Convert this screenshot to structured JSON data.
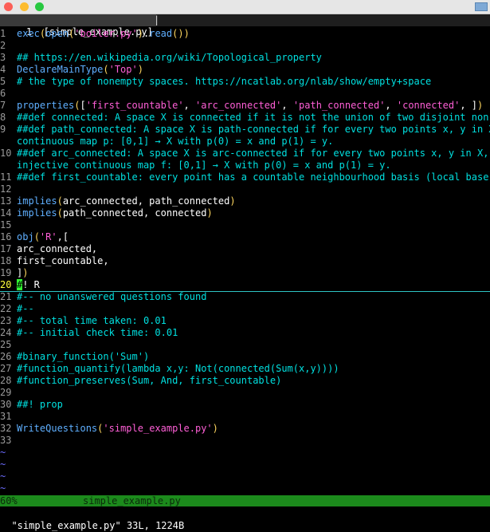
{
  "window": {
    "tab_number": "1",
    "tab_title": "[simple_example.py]",
    "tab_separator": "|"
  },
  "colors": {
    "function": "#5fafff",
    "string": "#ff5fd7",
    "paren": "#ffd75f",
    "comment": "#00e0e0",
    "normal": "#ffffff",
    "cursor": "#33ff33",
    "statusline_bg": "#1c8a1c"
  },
  "buffer": {
    "lines": [
      {
        "n": "1",
        "segs": [
          [
            "func",
            "exec"
          ],
          [
            "paren",
            "("
          ],
          [
            "func",
            "open"
          ],
          [
            "paren",
            "("
          ],
          [
            "str",
            "'boiler.py'"
          ],
          [
            "paren",
            ")"
          ],
          [
            "normal",
            "."
          ],
          [
            "func",
            "read"
          ],
          [
            "paren",
            "()"
          ],
          [
            "paren",
            ")"
          ]
        ]
      },
      {
        "n": "2",
        "segs": []
      },
      {
        "n": "3",
        "segs": [
          [
            "comment",
            "## https://en.wikipedia.org/wiki/Topological_property"
          ]
        ]
      },
      {
        "n": "4",
        "segs": [
          [
            "func",
            "DeclareMainType"
          ],
          [
            "paren",
            "("
          ],
          [
            "str",
            "'Top'"
          ],
          [
            "paren",
            ")"
          ]
        ]
      },
      {
        "n": "5",
        "segs": [
          [
            "comment",
            "# the type of nonempty spaces. https://ncatlab.org/nlab/show/empty+space"
          ]
        ]
      },
      {
        "n": "6",
        "segs": []
      },
      {
        "n": "7",
        "segs": [
          [
            "func",
            "properties"
          ],
          [
            "paren",
            "("
          ],
          [
            "normal",
            "["
          ],
          [
            "str",
            "'first_countable'"
          ],
          [
            "normal",
            ", "
          ],
          [
            "str",
            "'arc_connected'"
          ],
          [
            "normal",
            ", "
          ],
          [
            "str",
            "'path_connected'"
          ],
          [
            "normal",
            ", "
          ],
          [
            "str",
            "'connected'"
          ],
          [
            "normal",
            ", ]"
          ],
          [
            "paren",
            ")"
          ]
        ]
      },
      {
        "n": "8",
        "segs": [
          [
            "comment",
            "##def connected: A space X is connected if it is not the union of two disjoint non-em"
          ]
        ]
      },
      {
        "n": "9",
        "segs": [
          [
            "comment",
            "##def path_connected: A space X is path-connected if for every two points x, y in X,"
          ]
        ]
      },
      {
        "n": "",
        "segs": [
          [
            "comment",
            "continuous map p: [0,1] → X with p(0) = x and p(1) = y."
          ]
        ]
      },
      {
        "n": "10",
        "segs": [
          [
            "comment",
            "##def arc_connected: A space X is arc-connected if for every two points x, y in X, th"
          ]
        ]
      },
      {
        "n": "",
        "segs": [
          [
            "comment",
            "injective continuous map f: [0,1] → X with p(0) = x and p(1) = y."
          ]
        ]
      },
      {
        "n": "11",
        "segs": [
          [
            "comment",
            "##def first_countable: every point has a countable neighbourhood basis (local base)"
          ]
        ]
      },
      {
        "n": "12",
        "segs": []
      },
      {
        "n": "13",
        "segs": [
          [
            "func",
            "implies"
          ],
          [
            "paren",
            "("
          ],
          [
            "normal",
            "arc_connected, path_connected"
          ],
          [
            "paren",
            ")"
          ]
        ]
      },
      {
        "n": "14",
        "segs": [
          [
            "func",
            "implies"
          ],
          [
            "paren",
            "("
          ],
          [
            "normal",
            "path_connected, connected"
          ],
          [
            "paren",
            ")"
          ]
        ]
      },
      {
        "n": "15",
        "segs": []
      },
      {
        "n": "16",
        "segs": [
          [
            "func",
            "obj"
          ],
          [
            "paren",
            "("
          ],
          [
            "str",
            "'R'"
          ],
          [
            "normal",
            ",["
          ]
        ]
      },
      {
        "n": "17",
        "segs": [
          [
            "normal",
            "arc_connected,"
          ]
        ]
      },
      {
        "n": "18",
        "segs": [
          [
            "normal",
            "first_countable,"
          ]
        ]
      },
      {
        "n": "19",
        "segs": [
          [
            "normal",
            "]"
          ],
          [
            "paren",
            ")"
          ]
        ]
      },
      {
        "n": "20",
        "cur": true,
        "segs": [
          [
            "cursor",
            "#"
          ],
          [
            "normal",
            "! R"
          ]
        ]
      },
      {
        "n": "21",
        "segs": [
          [
            "comment",
            "#-- no unanswered questions found"
          ]
        ]
      },
      {
        "n": "22",
        "segs": [
          [
            "comment",
            "#--"
          ]
        ]
      },
      {
        "n": "23",
        "segs": [
          [
            "comment",
            "#-- total time taken: 0.01"
          ]
        ]
      },
      {
        "n": "24",
        "segs": [
          [
            "comment",
            "#-- initial check time: 0.01"
          ]
        ]
      },
      {
        "n": "25",
        "segs": []
      },
      {
        "n": "26",
        "segs": [
          [
            "comment",
            "#binary_function('Sum')"
          ]
        ]
      },
      {
        "n": "27",
        "segs": [
          [
            "comment",
            "#function_quantify(lambda x,y: Not(connected(Sum(x,y))))"
          ]
        ]
      },
      {
        "n": "28",
        "segs": [
          [
            "comment",
            "#function_preserves(Sum, And, first_countable)"
          ]
        ]
      },
      {
        "n": "29",
        "segs": []
      },
      {
        "n": "30",
        "segs": [
          [
            "comment",
            "##! prop"
          ]
        ]
      },
      {
        "n": "31",
        "segs": []
      },
      {
        "n": "32",
        "segs": [
          [
            "func",
            "WriteQuestions"
          ],
          [
            "paren",
            "("
          ],
          [
            "str",
            "'simple_example.py'"
          ],
          [
            "paren",
            ")"
          ]
        ]
      },
      {
        "n": "33",
        "segs": []
      },
      {
        "n": "~",
        "tilde": true,
        "segs": []
      },
      {
        "n": "~",
        "tilde": true,
        "segs": []
      },
      {
        "n": "~",
        "tilde": true,
        "segs": []
      },
      {
        "n": "~",
        "tilde": true,
        "segs": []
      }
    ]
  },
  "statusline": {
    "percent": "60%",
    "filename": "simple_example.py"
  },
  "cmdline": {
    "message": "\"simple_example.py\" 33L, 1224B"
  }
}
